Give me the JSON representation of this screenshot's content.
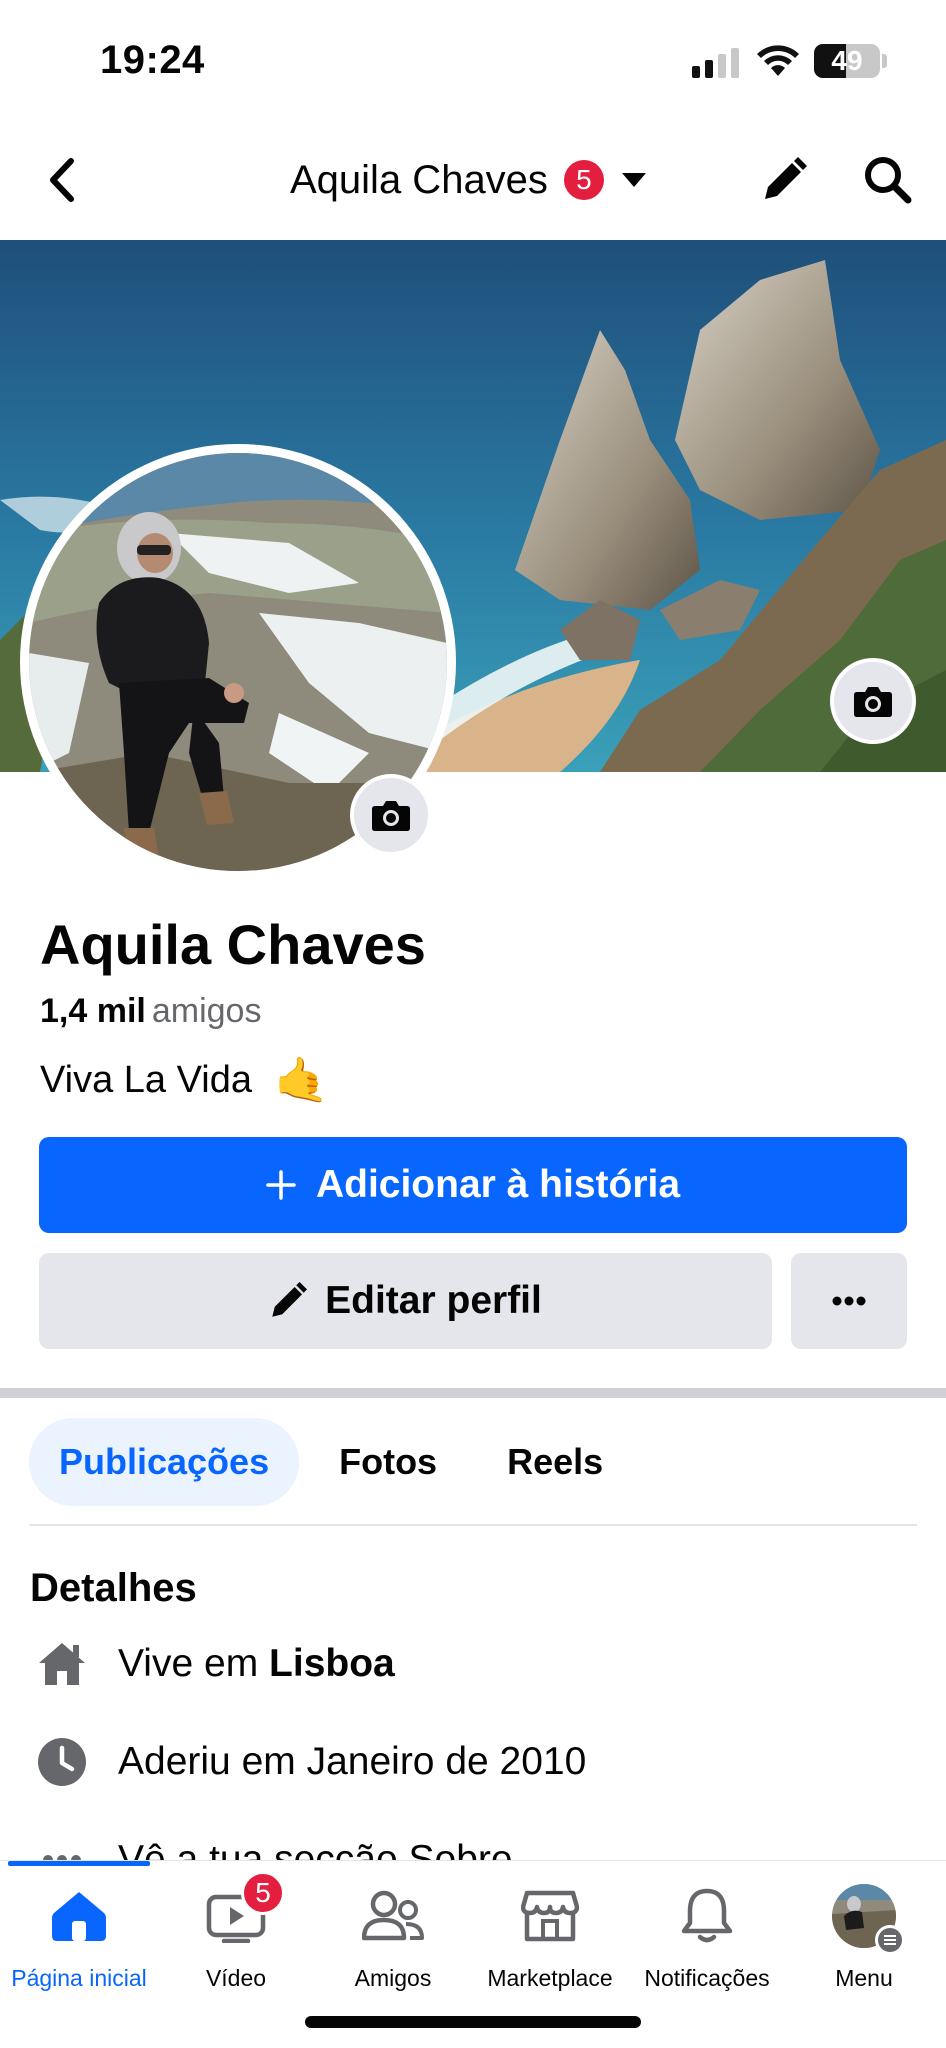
{
  "status_bar": {
    "time": "19:24",
    "battery_percent": "49",
    "battery_level": 0.49,
    "signal_bars": 2
  },
  "nav": {
    "title": "Aquila Chaves",
    "notification_count": "5",
    "icons": [
      "chevron-left-icon",
      "caret-down-icon",
      "pencil-icon",
      "search-icon"
    ]
  },
  "profile": {
    "name": "Aquila Chaves",
    "friends_count": "1,4 mil",
    "friends_label": "amigos",
    "bio": "Viva La Vida",
    "bio_emoji": "🤙"
  },
  "actions": {
    "add_story_label": "Adicionar à história",
    "edit_profile_label": "Editar perfil",
    "more_label": "•••"
  },
  "tabs": [
    {
      "label": "Publicações",
      "active": true
    },
    {
      "label": "Fotos",
      "active": false
    },
    {
      "label": "Reels",
      "active": false
    }
  ],
  "details": {
    "title": "Detalhes",
    "lives_prefix": "Vive em",
    "lives_city": "Lisboa",
    "joined": "Aderiu em Janeiro de 2010",
    "about": "Vê a tua secção Sobre"
  },
  "tabbar": {
    "items": [
      {
        "label": "Página inicial",
        "icon": "home-icon",
        "active": true
      },
      {
        "label": "Vídeo",
        "icon": "video-icon",
        "badge": "5"
      },
      {
        "label": "Amigos",
        "icon": "friends-icon"
      },
      {
        "label": "Marketplace",
        "icon": "marketplace-icon"
      },
      {
        "label": "Notificações",
        "icon": "bell-icon"
      },
      {
        "label": "Menu",
        "icon": "menu-avatar"
      }
    ]
  },
  "colors": {
    "brand_blue": "#0866ff",
    "badge_red": "#e41e3f",
    "secondary_button": "#e4e6eb",
    "secondary_text": "#65676b"
  }
}
